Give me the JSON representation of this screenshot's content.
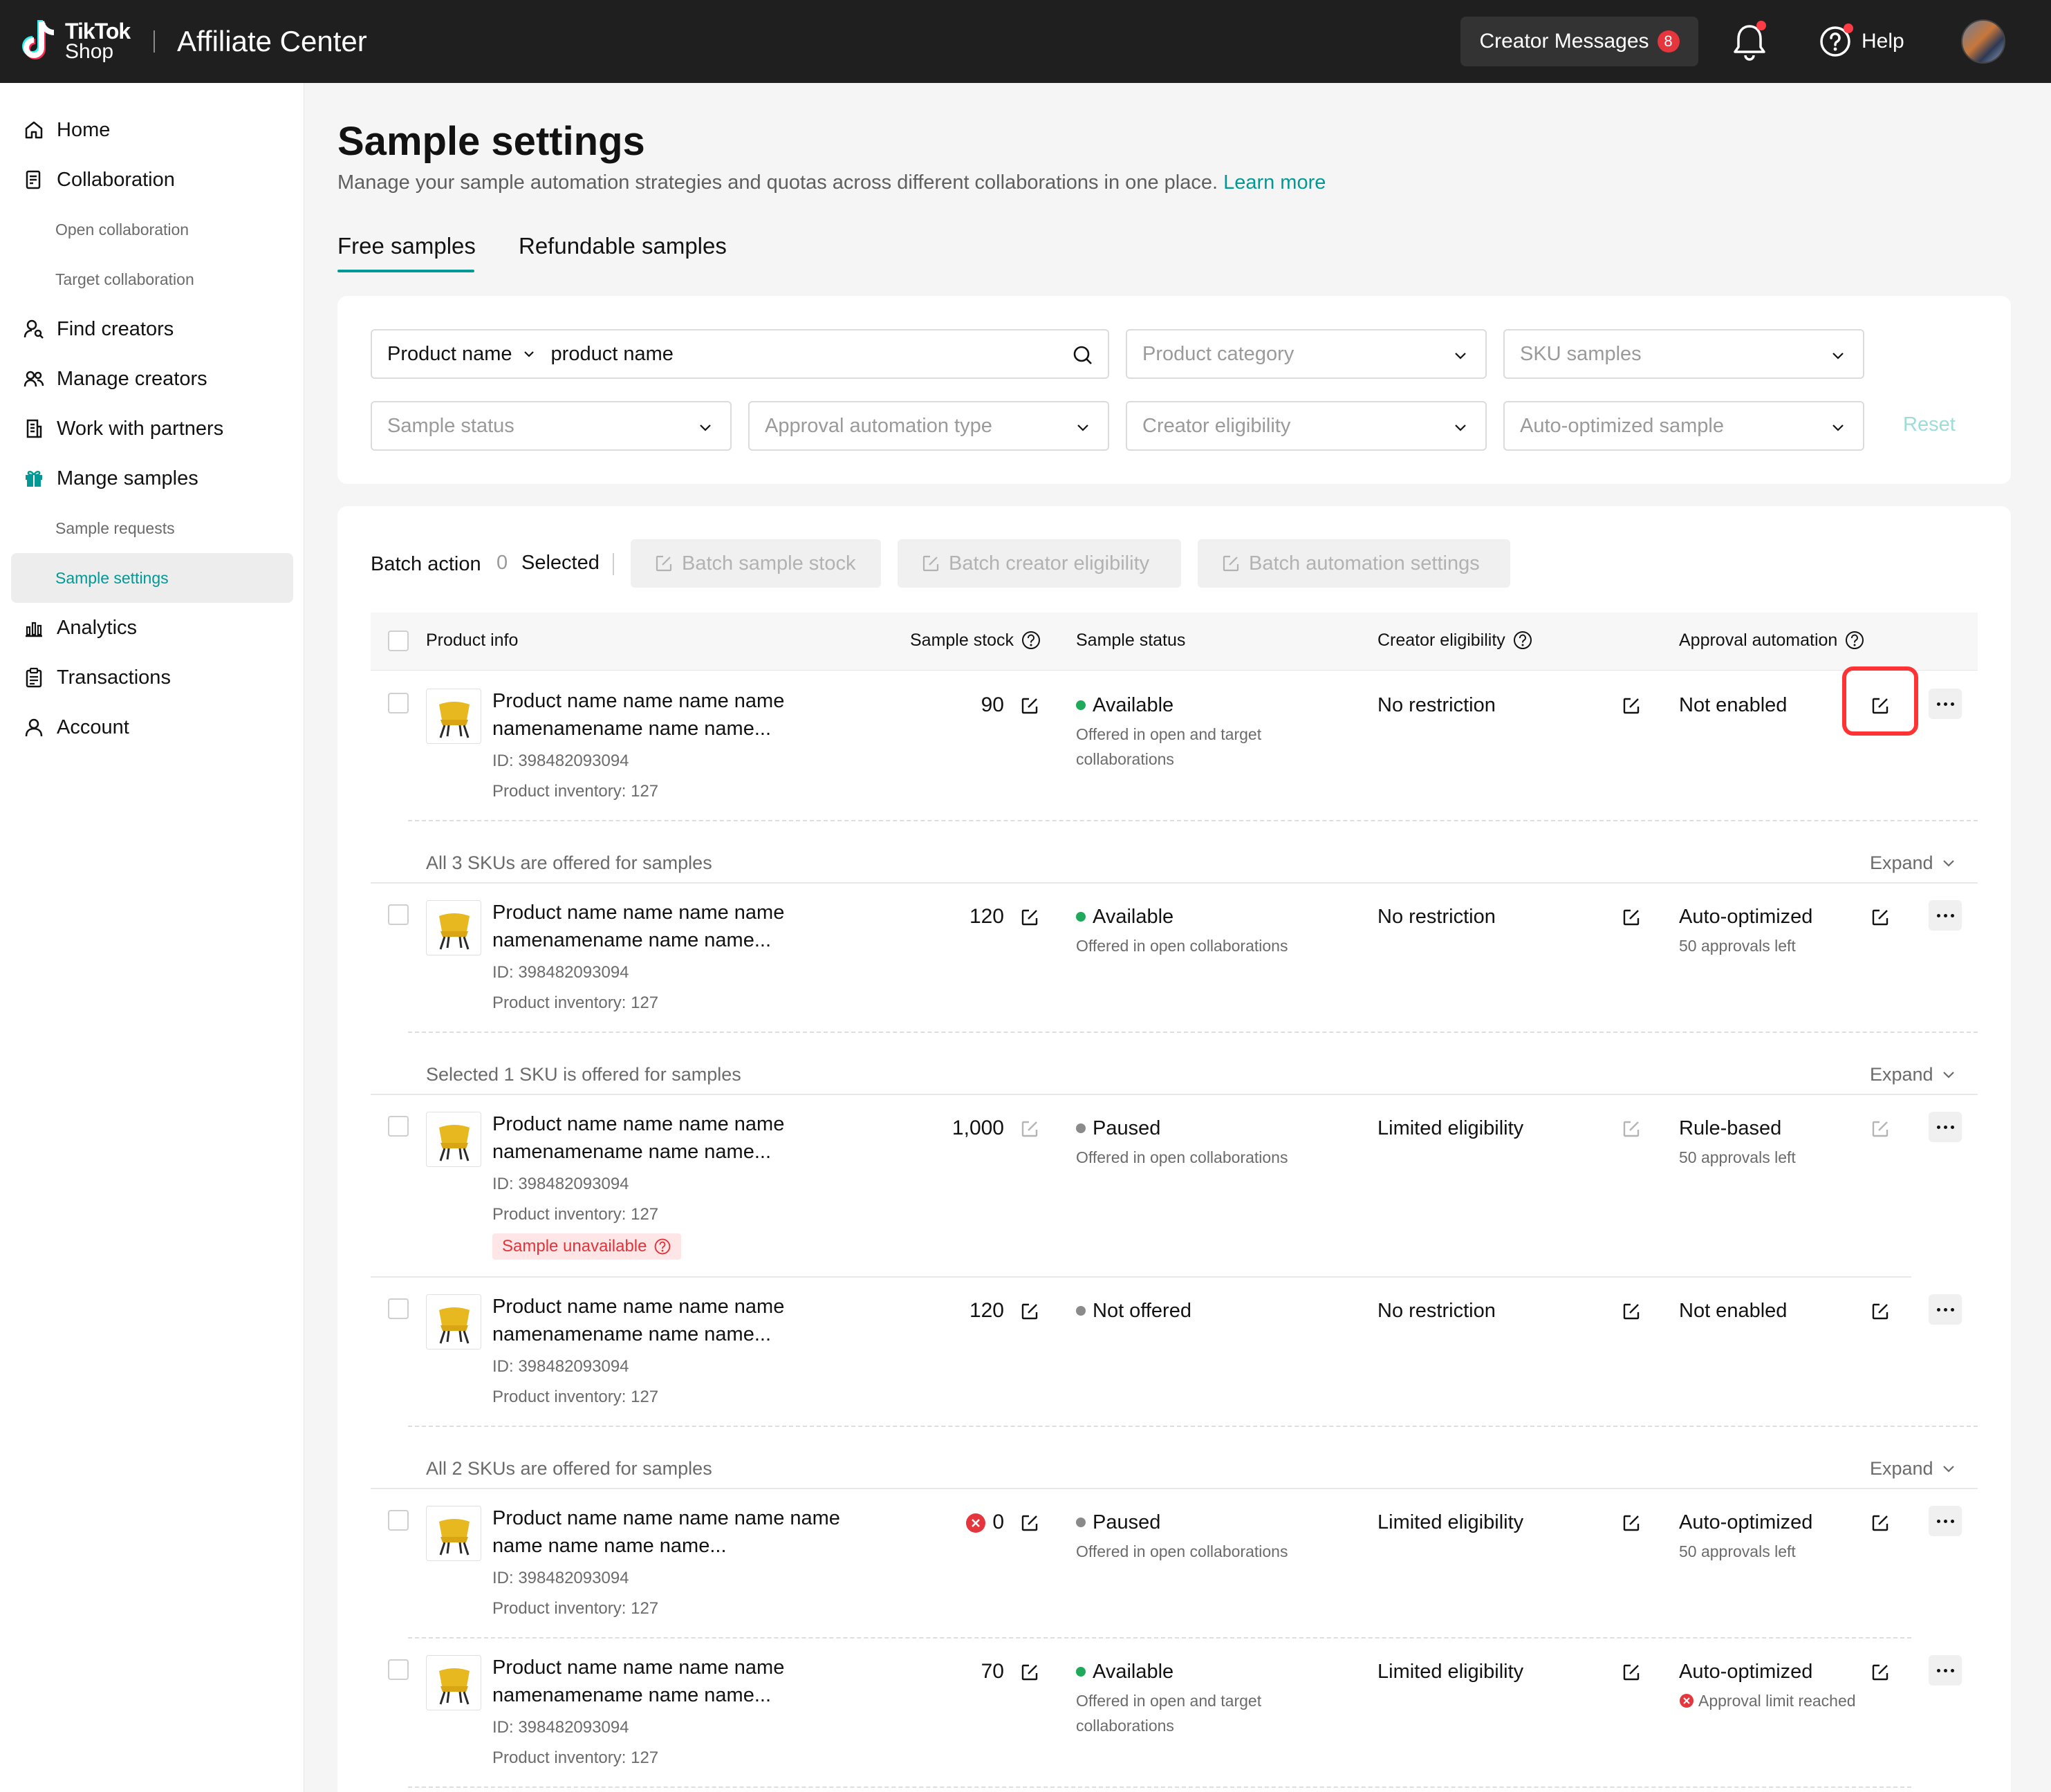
{
  "header": {
    "logo_line1": "TikTok",
    "logo_line2": "Shop",
    "app_title": "Affiliate Center",
    "messages_label": "Creator Messages",
    "messages_count": "8",
    "help_label": "Help"
  },
  "sidebar": {
    "items": [
      {
        "label": "Home",
        "icon": "home-icon"
      },
      {
        "label": "Collaboration",
        "icon": "collaboration-icon"
      },
      {
        "label": "Open collaboration"
      },
      {
        "label": "Target collaboration"
      },
      {
        "label": "Find creators",
        "icon": "find-creators-icon"
      },
      {
        "label": "Manage creators",
        "icon": "manage-creators-icon"
      },
      {
        "label": "Work with partners",
        "icon": "building-icon"
      },
      {
        "label": "Mange samples",
        "icon": "gift-icon"
      },
      {
        "label": "Sample requests"
      },
      {
        "label": "Sample settings",
        "active": true
      },
      {
        "label": "Analytics",
        "icon": "analytics-icon"
      },
      {
        "label": "Transactions",
        "icon": "clipboard-icon"
      },
      {
        "label": "Account",
        "icon": "account-icon"
      }
    ]
  },
  "page": {
    "title": "Sample settings",
    "description": "Manage your sample automation strategies and quotas across different collaborations in one place.",
    "learn_more": "Learn more",
    "tabs": [
      "Free samples",
      "Refundable samples"
    ]
  },
  "filters": {
    "search_type": "Product name",
    "search_value": "product name",
    "product_category": "Product category",
    "sku_samples": "SKU samples",
    "sample_status": "Sample status",
    "approval_automation_type": "Approval automation type",
    "creator_eligibility": "Creator eligibility",
    "auto_optimized_sample": "Auto-optimized sample",
    "reset": "Reset"
  },
  "batch": {
    "label": "Batch action",
    "count": "0",
    "selected": "Selected",
    "sample_stock": "Batch sample stock",
    "creator_eligibility": "Batch creator eligibility",
    "automation_settings": "Batch automation settings"
  },
  "columns": {
    "product_info": "Product info",
    "sample_stock": "Sample stock",
    "sample_status": "Sample status",
    "creator_eligibility": "Creator eligibility",
    "approval_automation": "Approval automation"
  },
  "rows": [
    {
      "name1": "Product name name name name",
      "name2": "namenamename name name...",
      "id": "ID: 398482093094",
      "inventory": "Product inventory: 127",
      "stock": "90",
      "status": "Available",
      "status_color": "#1fa95a",
      "status_sub1": "Offered in open and target",
      "status_sub2": "collaborations",
      "eligibility": "No restriction",
      "approval": "Not enabled",
      "approval_sub": "",
      "sku_line": "All 3 SKUs are offered for samples",
      "expand": "Expand"
    },
    {
      "name1": "Product name name name name",
      "name2": "namenamename name name...",
      "id": "ID: 398482093094",
      "inventory": "Product inventory: 127",
      "stock": "120",
      "status": "Available",
      "status_color": "#1fa95a",
      "status_sub1": "Offered in open collaborations",
      "status_sub2": "",
      "eligibility": "No restriction",
      "approval": "Auto-optimized",
      "approval_sub": "50 approvals left",
      "sku_line": "Selected 1 SKU is offered for samples",
      "expand": "Expand"
    },
    {
      "name1": "Product name name name name",
      "name2": "namenamename name name...",
      "id": "ID: 398482093094",
      "inventory": "Product inventory: 127",
      "stock": "1,000",
      "status": "Paused",
      "status_color": "#8a8a8a",
      "status_sub1": "Offered in open collaborations",
      "status_sub2": "",
      "eligibility": "Limited eligibility",
      "approval": "Rule-based",
      "approval_sub": "50 approvals left",
      "tag": "Sample unavailable"
    },
    {
      "name1": "Product name name name name",
      "name2": "namenamename name name...",
      "id": "ID: 398482093094",
      "inventory": "Product inventory: 127",
      "stock": "120",
      "status": "Not offered",
      "status_color": "#8a8a8a",
      "status_sub1": "",
      "status_sub2": "",
      "eligibility": "No restriction",
      "approval": "Not enabled",
      "approval_sub": "",
      "sku_line": "All 2 SKUs are offered for samples",
      "expand": "Expand"
    },
    {
      "name1": "Product name name name name name",
      "name2": "name name name name...",
      "id": "ID: 398482093094",
      "inventory": "Product inventory: 127",
      "stock": "0",
      "status": "Paused",
      "status_color": "#8a8a8a",
      "status_sub1": "Offered in open collaborations",
      "status_sub2": "",
      "eligibility": "Limited eligibility",
      "approval": "Auto-optimized",
      "approval_sub": "50 approvals left"
    },
    {
      "name1": "Product name name name name",
      "name2": "namenamename name name...",
      "id": "ID: 398482093094",
      "inventory": "Product inventory: 127",
      "stock": "70",
      "status": "Available",
      "status_color": "#1fa95a",
      "status_sub1": "Offered in open and target",
      "status_sub2": "collaborations",
      "eligibility": "Limited eligibility",
      "approval": "Auto-optimized",
      "approval_sub": "Approval limit reached"
    }
  ],
  "colors": {
    "accent": "#009995",
    "header_bg": "#1f1f1f",
    "danger": "#e5353d"
  }
}
